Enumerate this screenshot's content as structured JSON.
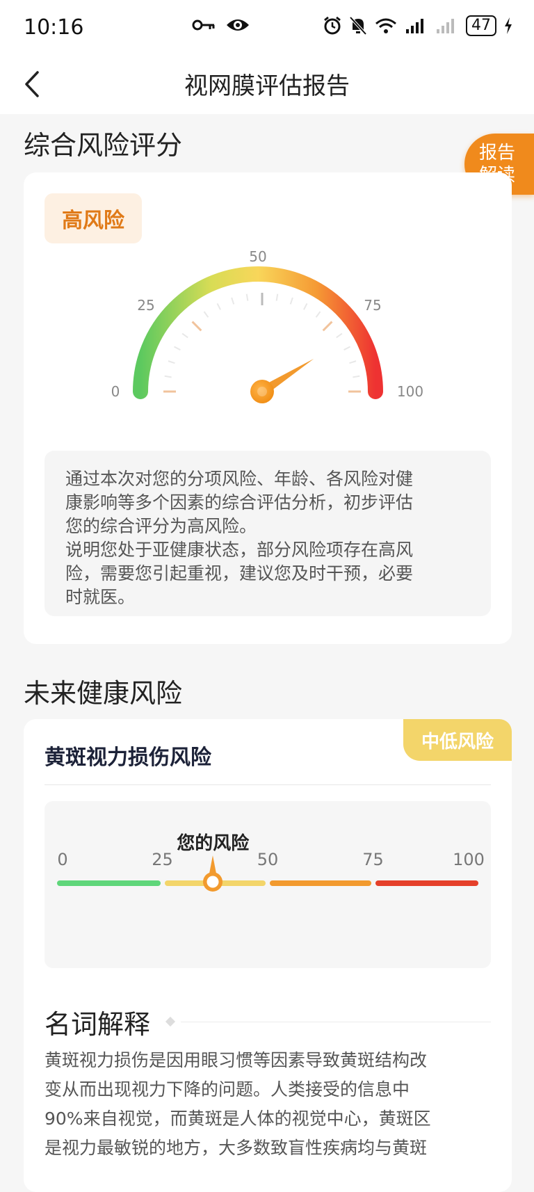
{
  "status_bar": {
    "time": "10:16",
    "battery": "47"
  },
  "nav": {
    "title": "视网膜评估报告"
  },
  "float_tab": {
    "line1": "报告",
    "line2": "解读"
  },
  "overall": {
    "section_title": "综合风险评分",
    "risk_label": "高风险",
    "gauge": {
      "ticks": [
        "0",
        "25",
        "50",
        "75",
        "100"
      ],
      "value": 82
    },
    "description_lines": [
      "通过本次对您的分项风险、年龄、各风险对健",
      "康影响等多个因素的综合评估分析，初步评估",
      "您的综合评分为高风险。",
      "说明您处于亚健康状态，部分风险项存在高风",
      "险，需要您引起重视，建议您及时干预，必要",
      "时就医。"
    ]
  },
  "future": {
    "section_title": "未来健康风险",
    "card": {
      "title": "黄斑视力损伤风险",
      "badge": "中低风险",
      "your_risk_label": "您的风险",
      "ticks": [
        "0",
        "25",
        "50",
        "75",
        "100"
      ],
      "risk_value": 37,
      "segment_colors": [
        "#5fd67a",
        "#f3d56a",
        "#f29a2e",
        "#e5402a"
      ]
    },
    "term": {
      "title": "名词解释",
      "lines": [
        "黄斑视力损伤是因用眼习惯等因素导致黄斑结构改",
        "变从而出现视力下降的问题。人类接受的信息中",
        "90%来自视觉，而黄斑是人体的视觉中心，黄斑区",
        "是视力最敏锐的地方，大多数致盲性疾病均与黄斑"
      ]
    }
  }
}
